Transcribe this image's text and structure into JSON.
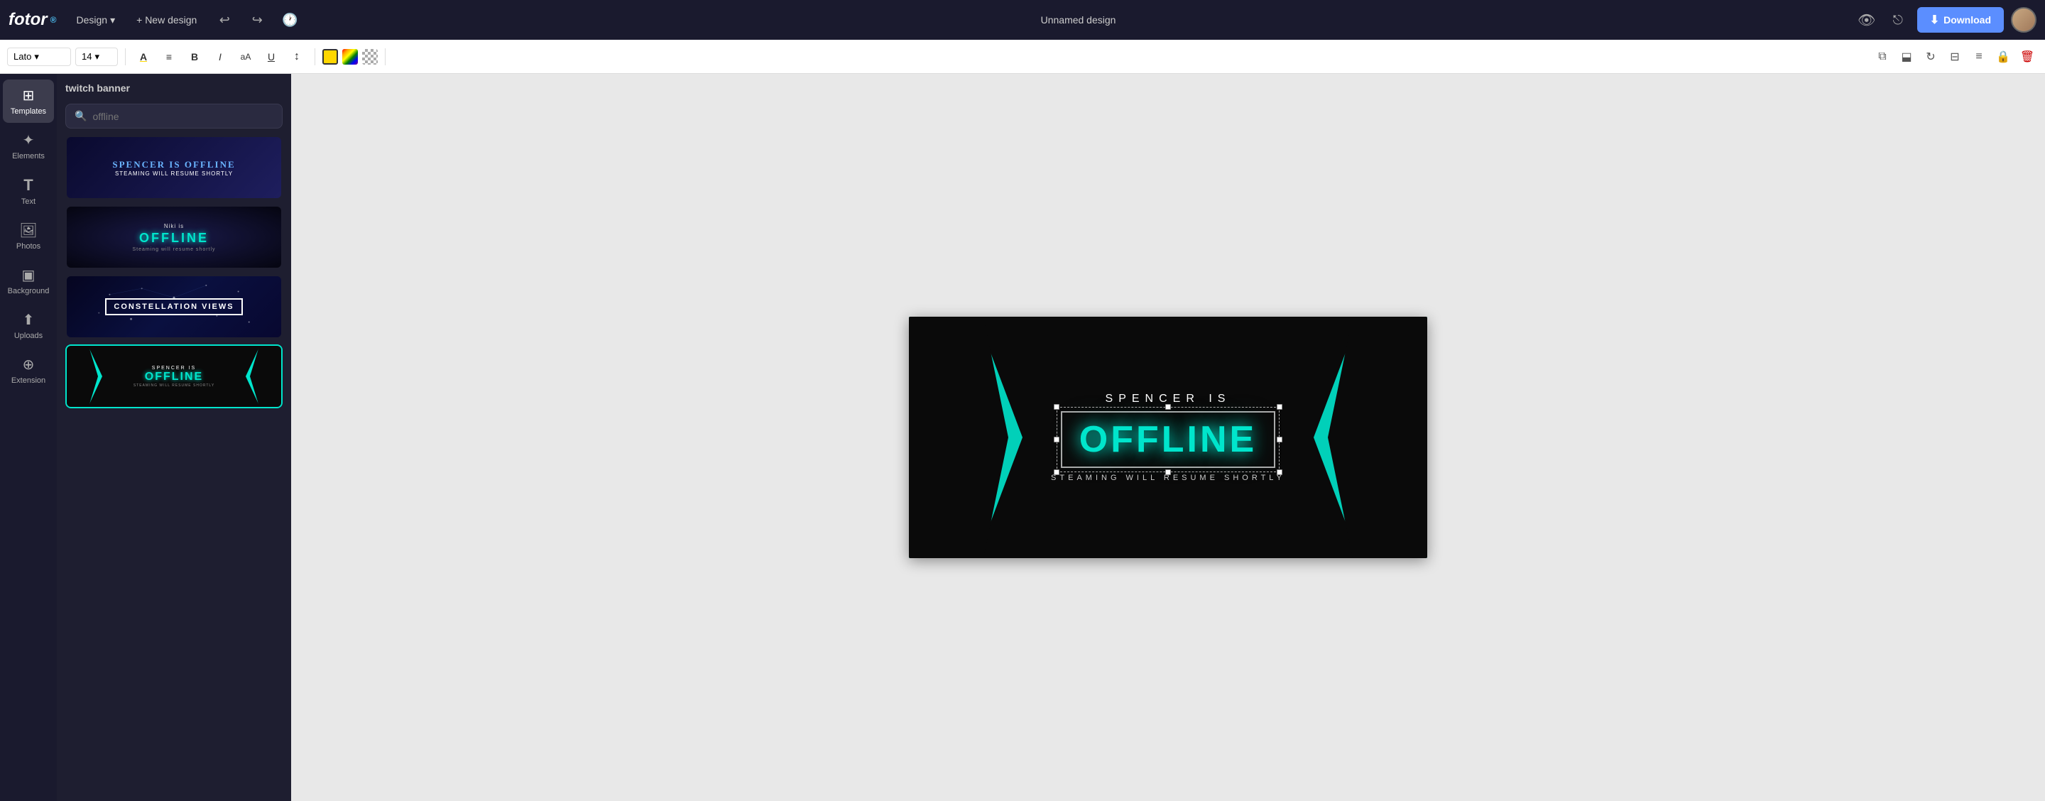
{
  "app": {
    "logo": "fotor",
    "logo_sup": "®"
  },
  "topnav": {
    "design_label": "Design",
    "new_design_label": "+ New design",
    "title": "Unnamed design",
    "download_label": "Download"
  },
  "toolbar": {
    "font": "Lato",
    "font_size": "14",
    "bold_label": "B",
    "italic_label": "I",
    "underline_label": "U"
  },
  "sidebar": {
    "items": [
      {
        "id": "templates",
        "label": "Templates",
        "icon": "⊞"
      },
      {
        "id": "elements",
        "label": "Elements",
        "icon": "✦"
      },
      {
        "id": "text",
        "label": "Text",
        "icon": "T"
      },
      {
        "id": "photos",
        "label": "Photos",
        "icon": "🖼"
      },
      {
        "id": "background",
        "label": "Background",
        "icon": "▣"
      },
      {
        "id": "uploads",
        "label": "Uploads",
        "icon": "⬆"
      },
      {
        "id": "extension",
        "label": "Extension",
        "icon": "⊕"
      }
    ]
  },
  "panel": {
    "title": "twitch banner",
    "search_placeholder": "offline",
    "templates": [
      {
        "id": "tpl1",
        "type": "dark-blue"
      },
      {
        "id": "tpl2",
        "type": "starfield",
        "selected": false
      },
      {
        "id": "tpl3",
        "type": "constellation"
      },
      {
        "id": "tpl4",
        "type": "cyan-arrows",
        "selected": true
      }
    ]
  },
  "canvas": {
    "spencer_is": "SPENCER   IS",
    "offline": "OFFLINE",
    "subtitle": "STEAMING WILL RESUME SHORTLY",
    "tpl1_main": "SPENCER IS OFFLINE",
    "tpl1_sub": "STEAMING WILL RESUME SHORTLY",
    "tpl2_name": "Niki is",
    "tpl2_offline": "OFFLINE",
    "tpl2_sub": "Steaming will resume shortly",
    "tpl3_text": "CONSTELLATION VIEWS",
    "tpl4_spencer": "SPENCER IS",
    "tpl4_offline": "OFFLINE",
    "tpl4_sub": "STEAMING WILL RESUME SHORTLY"
  },
  "icons": {
    "search": "🔍",
    "undo": "↩",
    "redo": "↪",
    "history": "🕐",
    "eye": "👁",
    "share": "⎋",
    "download_icon": "⬇",
    "chevron": "▾",
    "font_color": "A",
    "align": "≡",
    "bold": "B",
    "italic": "I",
    "aa": "aA",
    "underline": "U",
    "height": "↕",
    "color_fill": "🎨",
    "gradient": "✦",
    "opacity": "⬚",
    "copy": "⧉",
    "align_v": "⬓",
    "rotate_cw": "↻",
    "align_h": "⬓",
    "layers": "≡",
    "lock": "🔒",
    "delete": "🗑"
  }
}
